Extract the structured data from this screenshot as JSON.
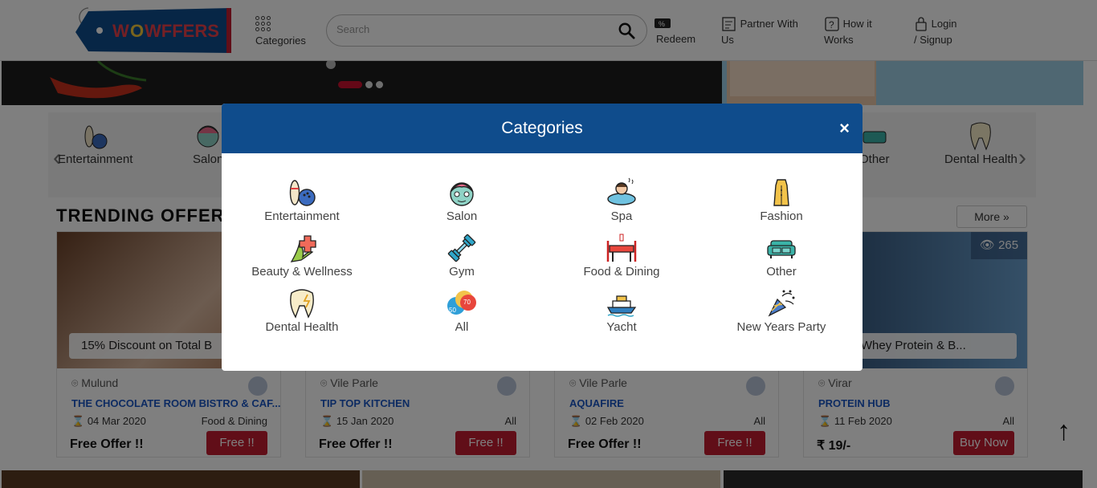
{
  "header": {
    "brand": "WOWFFERS",
    "categories_label": "Categories",
    "search_placeholder": "Search",
    "redeem_label": "Redeem",
    "partner_label_1": "Partner With",
    "partner_label_2": "Us",
    "how_label_1": "How it",
    "how_label_2": "Works",
    "login_label_1": "Login",
    "login_label_2": "/ Signup"
  },
  "category_strip": {
    "items": [
      "Entertainment",
      "Salon",
      "Other",
      "Dental Health"
    ]
  },
  "trending": {
    "title": "TRENDING OFFER",
    "more_label": "More »"
  },
  "cards": [
    {
      "offer": "15% Discount on Total B",
      "location": "Mulund",
      "merchant": "THE CHOCOLATE ROOM BISTRO & CAF...",
      "date": "04 Mar 2020",
      "category": "Food & Dining",
      "price": "Free Offer !!",
      "cta": "Free !!"
    },
    {
      "offer": "",
      "location": "Vile Parle",
      "merchant": "TIP TOP KITCHEN",
      "date": "15 Jan 2020",
      "category": "All",
      "price": "Free Offer !!",
      "cta": "Free !!"
    },
    {
      "offer": "",
      "location": "Vile Parle",
      "merchant": "AQUAFIRE",
      "date": "02 Feb 2020",
      "category": "All",
      "price": "Free Offer !!",
      "cta": "Free !!"
    },
    {
      "offer": "on All Whey Protein & B...",
      "views": "265",
      "location": "Virar",
      "merchant": "PROTEIN HUB",
      "date": "11 Feb 2020",
      "category": "All",
      "price": "₹ 19/-",
      "cta": "Buy Now"
    }
  ],
  "modal": {
    "title": "Categories",
    "close": "×",
    "categories": [
      {
        "label": "Entertainment",
        "icon": "bowling-icon"
      },
      {
        "label": "Salon",
        "icon": "face-mask-icon"
      },
      {
        "label": "Spa",
        "icon": "spa-icon"
      },
      {
        "label": "Fashion",
        "icon": "dress-icon"
      },
      {
        "label": "Beauty & Wellness",
        "icon": "leaf-plus-icon"
      },
      {
        "label": "Gym",
        "icon": "dumbbell-icon"
      },
      {
        "label": "Food & Dining",
        "icon": "dining-table-icon"
      },
      {
        "label": "Other",
        "icon": "sofa-icon"
      },
      {
        "label": "Dental Health",
        "icon": "tooth-icon"
      },
      {
        "label": "All",
        "icon": "discount-tags-icon"
      },
      {
        "label": "Yacht",
        "icon": "yacht-icon"
      },
      {
        "label": "New Years Party",
        "icon": "party-popper-icon"
      }
    ]
  },
  "colors": {
    "brand_blue": "#0f4c8c",
    "brand_red": "#c21c30",
    "link_blue": "#1a56c4"
  }
}
